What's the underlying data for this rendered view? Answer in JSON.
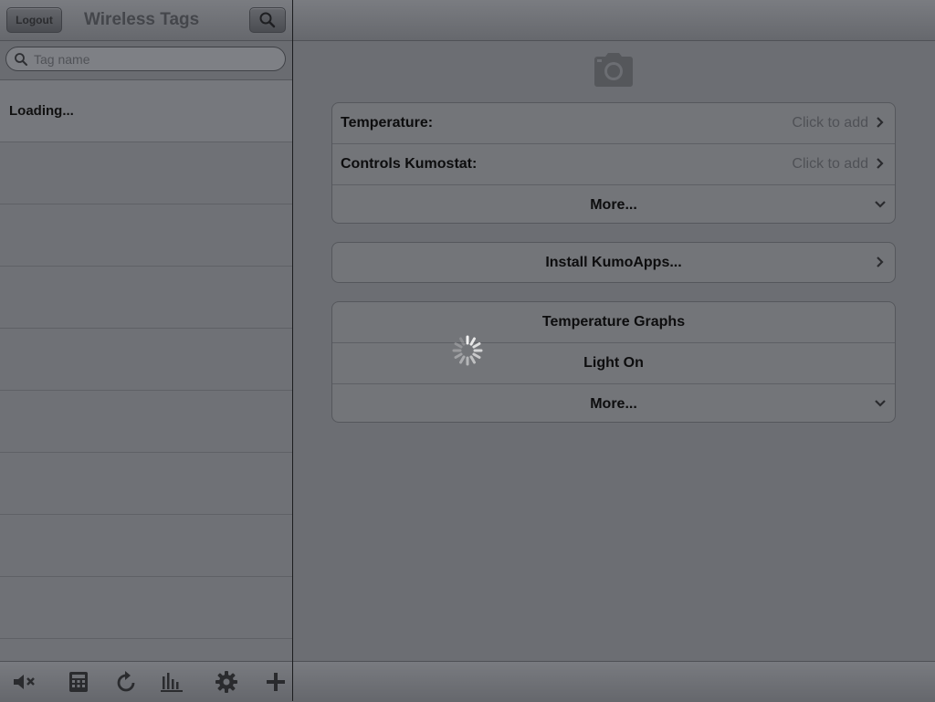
{
  "left": {
    "logout_label": "Logout",
    "title": "Wireless Tags",
    "search_placeholder": "Tag name",
    "loading_text": "Loading..."
  },
  "settings_group": {
    "rows": [
      {
        "label": "Temperature:",
        "value": "Click to add"
      },
      {
        "label": "Controls Kumostat:",
        "value": "Click to add"
      },
      {
        "label": "More..."
      }
    ]
  },
  "install_label": "Install KumoApps...",
  "apps_group": {
    "rows": [
      {
        "label": "Temperature Graphs"
      },
      {
        "label": "Light On"
      },
      {
        "label": "More..."
      }
    ]
  },
  "toolbar_icons": [
    "mute-icon",
    "calculator-icon",
    "refresh-icon",
    "bar-chart-icon",
    "gear-icon",
    "plus-icon"
  ],
  "colors": {
    "background": "#6c6e73",
    "divider": "#1c1d1f",
    "text": "#0d0d0e",
    "muted": "#4f5156"
  }
}
